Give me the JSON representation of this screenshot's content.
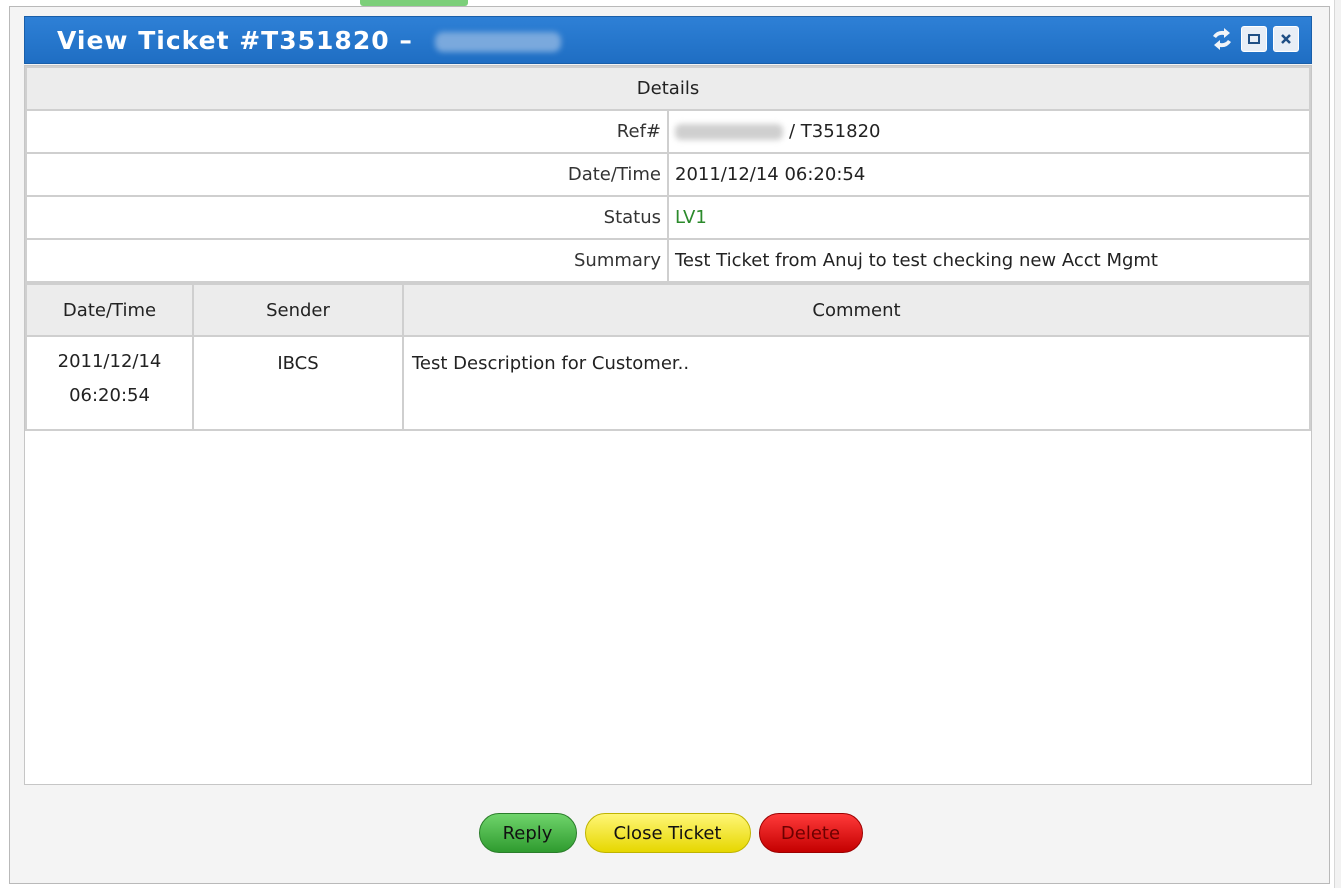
{
  "dialog": {
    "title": "View Ticket #T351820 –",
    "icons": [
      "refresh-icon",
      "maximize-icon",
      "close-icon"
    ]
  },
  "details": {
    "header": "Details",
    "rows": [
      {
        "label": "Ref#",
        "value": "/ T351820"
      },
      {
        "label": "Date/Time",
        "value": "2011/12/14 06:20:54"
      },
      {
        "label": "Status",
        "value": "LV1"
      },
      {
        "label": "Summary",
        "value": "Test Ticket from Anuj to test checking new Acct Mgmt"
      }
    ]
  },
  "log": {
    "columns": [
      "Date/Time",
      "Sender",
      "Comment"
    ],
    "rows": [
      {
        "date": "2011/12/14",
        "time": "06:20:54",
        "sender": "IBCS",
        "comment": "Test Description for Customer.."
      }
    ]
  },
  "buttons": {
    "reply": "Reply",
    "close_ticket": "Close Ticket",
    "delete": "Delete"
  },
  "colors": {
    "titlebar": "#1f6ec3",
    "status": "#2b8a2b",
    "reply": "#2f9b2f",
    "close_ticket": "#e6d700",
    "delete": "#c40000"
  }
}
